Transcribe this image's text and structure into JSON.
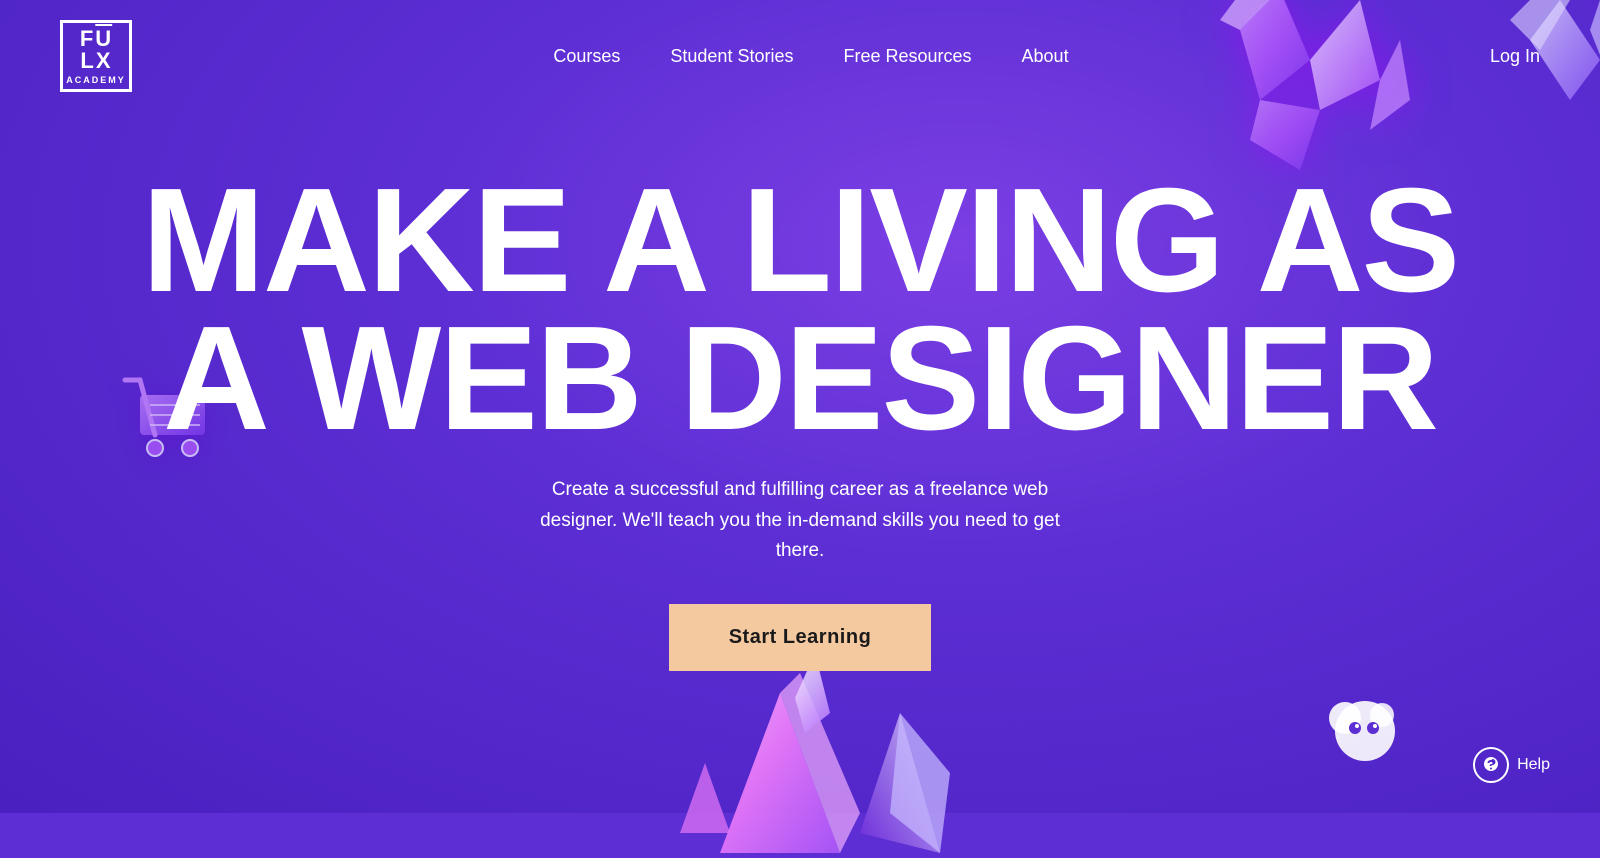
{
  "meta": {
    "bg_color": "#5c2ed4",
    "accent_color": "#f5c9a0"
  },
  "logo": {
    "line1": "FU LX",
    "line2": "ACADEMY",
    "alt": "Flux Academy"
  },
  "nav": {
    "links": [
      {
        "label": "Courses",
        "id": "courses"
      },
      {
        "label": "Student Stories",
        "id": "student-stories"
      },
      {
        "label": "Free Resources",
        "id": "free-resources"
      },
      {
        "label": "About",
        "id": "about"
      }
    ],
    "login_label": "Log In"
  },
  "hero": {
    "headline_line1": "MAKE A LIVING AS",
    "headline_line2": "A WEB DESIGNER",
    "subtext": "Create a successful and fulfilling career as a freelance web designer. We'll teach you the in-demand skills you need to get there.",
    "cta_label": "Start Learning"
  },
  "help": {
    "label": "Help"
  }
}
